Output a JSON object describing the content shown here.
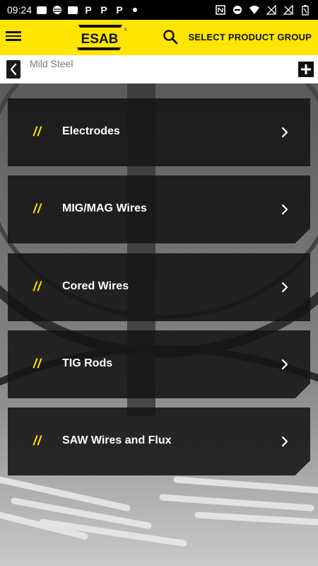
{
  "status_bar": {
    "time": "09:24"
  },
  "app_bar": {
    "brand": "ESAB",
    "select_group_label": "SELECT PRODUCT GROUP",
    "accent_color": "#ffe500"
  },
  "breadcrumb": {
    "label": "Mild Steel"
  },
  "cards": [
    {
      "slash": "//",
      "label": "Electrodes"
    },
    {
      "slash": "//",
      "label": "MIG/MAG Wires"
    },
    {
      "slash": "//",
      "label": "Cored Wires"
    },
    {
      "slash": "//",
      "label": "TIG Rods"
    },
    {
      "slash": "//",
      "label": "SAW Wires and Flux"
    }
  ]
}
